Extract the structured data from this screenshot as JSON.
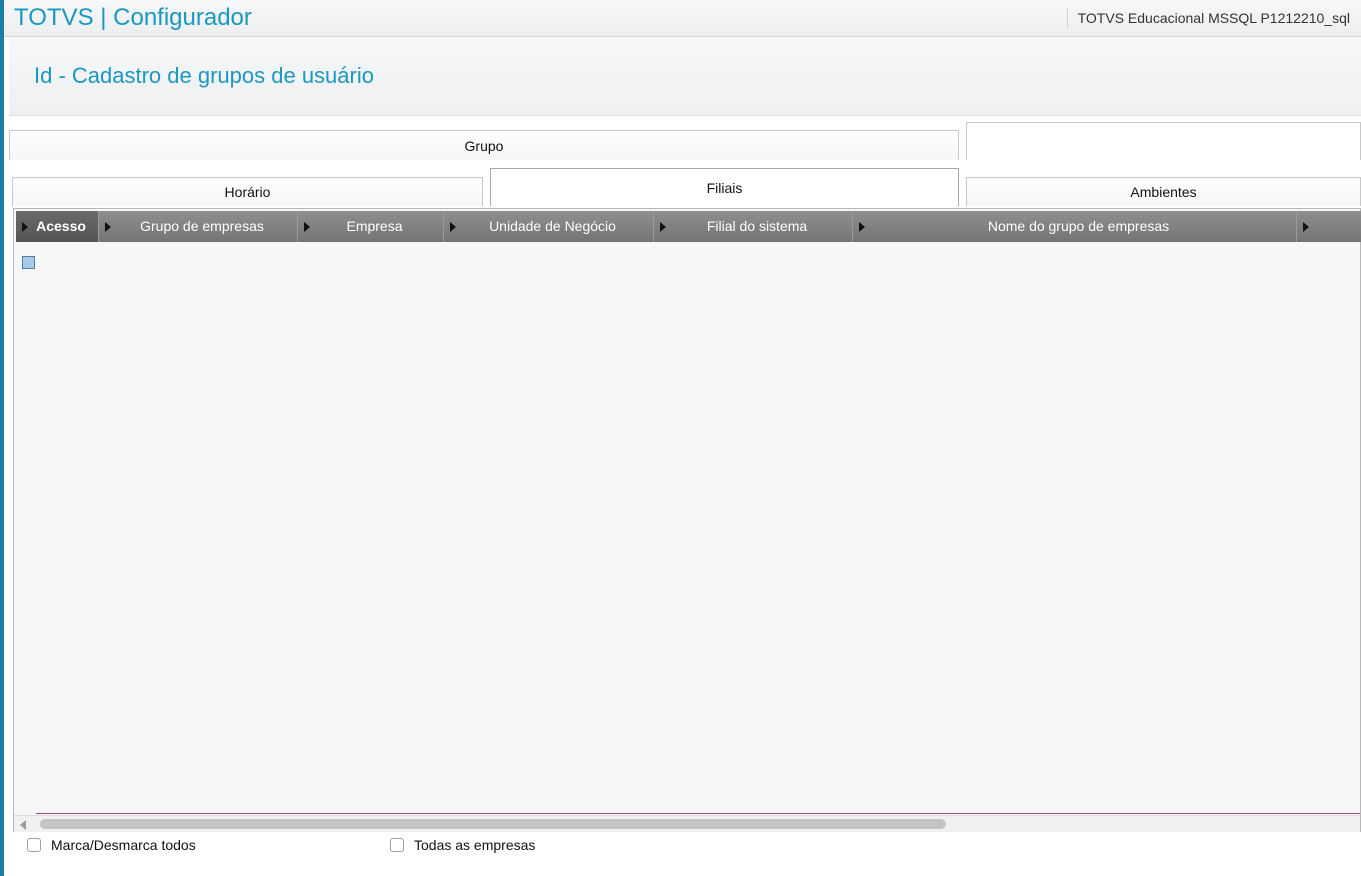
{
  "app": {
    "title": "TOTVS | Configurador",
    "environment": "TOTVS Educacional MSSQL P1212210_sql"
  },
  "page": {
    "title": "Id - Cadastro de grupos de usuário"
  },
  "tabs": {
    "row1": [
      {
        "label": "Grupo"
      },
      {
        "label": ""
      }
    ],
    "row2": [
      {
        "label": "Horário"
      },
      {
        "label": "Filiais",
        "active": true
      },
      {
        "label": "Ambientes"
      }
    ]
  },
  "grid": {
    "columns": [
      {
        "label": "Acesso",
        "selected": true
      },
      {
        "label": "Grupo de empresas"
      },
      {
        "label": "Empresa"
      },
      {
        "label": "Unidade de Negócio"
      },
      {
        "label": "Filial do sistema"
      },
      {
        "label": "Nome do grupo de empresas"
      },
      {
        "label": ""
      }
    ],
    "rows": [
      {
        "acesso_checked": false
      }
    ]
  },
  "options": {
    "marca_desmarca": {
      "label": "Marca/Desmarca todos",
      "checked": false
    },
    "todas_empresas": {
      "label": "Todas as empresas",
      "checked": false
    }
  },
  "colors": {
    "accent": "#1a98bf",
    "header_gray": "#808080",
    "selected_header": "#5e5e5e"
  }
}
